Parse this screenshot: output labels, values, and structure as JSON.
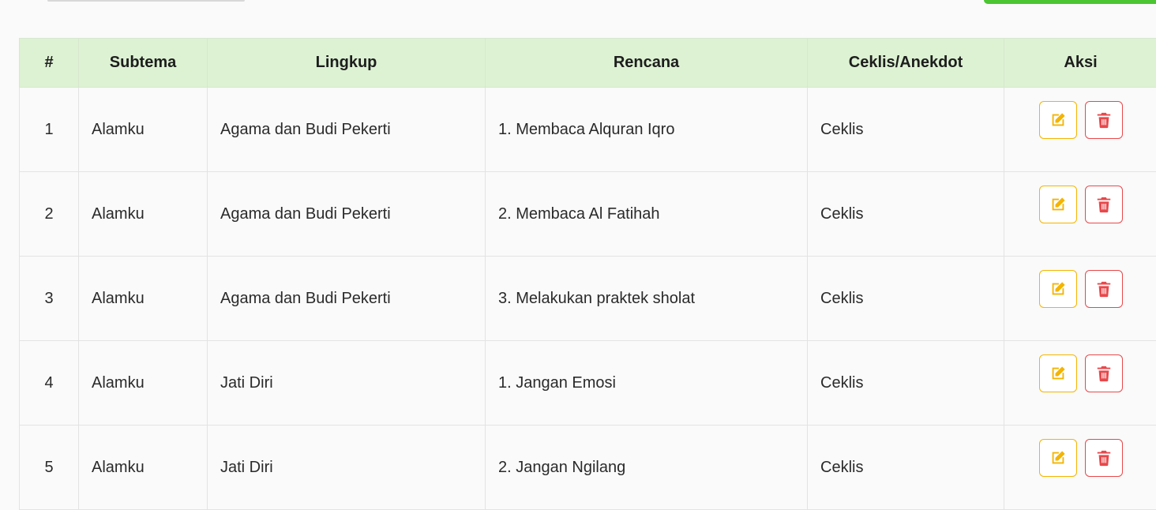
{
  "colors": {
    "header_bg": "#ddf2d3",
    "edit_accent": "#f4b400",
    "delete_accent": "#e8484b",
    "top_button": "#4bc532"
  },
  "table": {
    "headers": [
      "#",
      "Subtema",
      "Lingkup",
      "Rencana",
      "Ceklis/Anekdot",
      "Aksi"
    ],
    "rows": [
      {
        "no": "1",
        "subtema": "Alamku",
        "lingkup": "Agama dan Budi Pekerti",
        "rencana": "1. Membaca Alquran Iqro",
        "tipe": "Ceklis"
      },
      {
        "no": "2",
        "subtema": "Alamku",
        "lingkup": "Agama dan Budi Pekerti",
        "rencana": "2. Membaca Al Fatihah",
        "tipe": "Ceklis"
      },
      {
        "no": "3",
        "subtema": "Alamku",
        "lingkup": "Agama dan Budi Pekerti",
        "rencana": "3. Melakukan praktek sholat",
        "tipe": "Ceklis"
      },
      {
        "no": "4",
        "subtema": "Alamku",
        "lingkup": "Jati Diri",
        "rencana": "1. Jangan Emosi",
        "tipe": "Ceklis"
      },
      {
        "no": "5",
        "subtema": "Alamku",
        "lingkup": "Jati Diri",
        "rencana": "2. Jangan Ngilang",
        "tipe": "Ceklis"
      }
    ]
  },
  "icons": {
    "edit": "edit-icon",
    "delete": "trash-icon"
  }
}
